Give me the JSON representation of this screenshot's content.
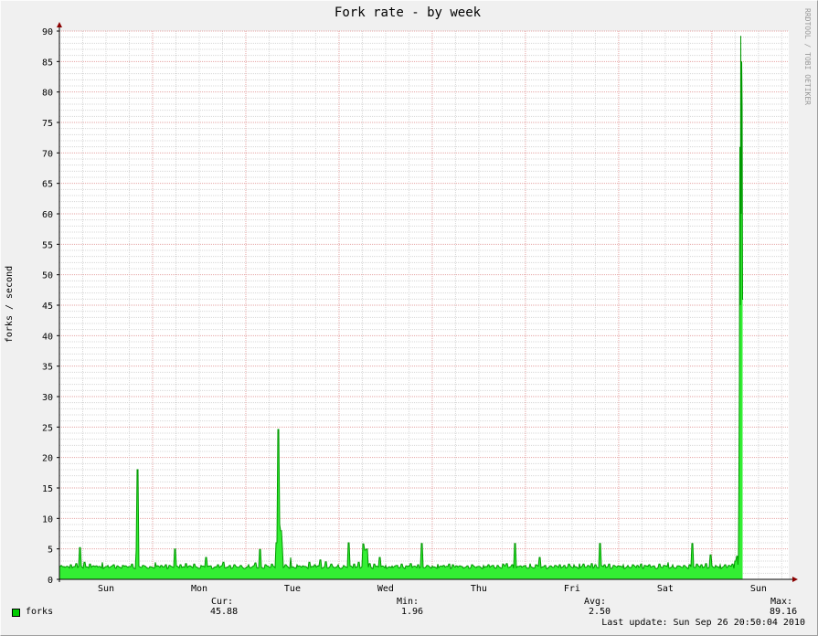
{
  "chart_data": {
    "type": "area",
    "title": "Fork rate - by week",
    "ylabel": "forks / second",
    "watermark": "RRDTOOL / TOBI OETIKER",
    "ylim": [
      0,
      90
    ],
    "y_ticks": [
      0,
      5,
      10,
      15,
      20,
      25,
      30,
      35,
      40,
      45,
      50,
      55,
      60,
      65,
      70,
      75,
      80,
      85,
      90
    ],
    "x_day_labels": [
      "Sun",
      "Mon",
      "Tue",
      "Wed",
      "Thu",
      "Fri",
      "Sat",
      "Sun"
    ],
    "x_range_days": [
      0,
      7.825
    ],
    "grid": true,
    "colors": {
      "background": "#f0f0f0",
      "canvas": "#ffffff",
      "area": "#00cc00",
      "area_fill": "#33ee33",
      "line": "#009900",
      "major_grid": "#e6a6a6",
      "minor_grid": "#d8d8d8",
      "axis": "#000000",
      "arrow": "#8b0000"
    },
    "series": [
      {
        "name": "forks",
        "baseline": 2.0,
        "spikes": [
          [
            0.02,
            2.3
          ],
          [
            0.05,
            2.1
          ],
          [
            0.12,
            2.4
          ],
          [
            0.18,
            2.6
          ],
          [
            0.22,
            5.2
          ],
          [
            0.27,
            2.8
          ],
          [
            0.33,
            2.5
          ],
          [
            0.4,
            2.2
          ],
          [
            0.46,
            2.8
          ],
          [
            0.52,
            2.3
          ],
          [
            0.58,
            2.4
          ],
          [
            0.62,
            2.2
          ],
          [
            0.68,
            2.3
          ],
          [
            0.75,
            2.1
          ],
          [
            0.78,
            2.5
          ],
          [
            0.83,
            4.8
          ],
          [
            0.84,
            18.0
          ],
          [
            0.9,
            2.3
          ],
          [
            0.97,
            2.1
          ],
          [
            1.03,
            2.8
          ],
          [
            1.09,
            2.3
          ],
          [
            1.14,
            2.4
          ],
          [
            1.18,
            2.3
          ],
          [
            1.24,
            5.0
          ],
          [
            1.3,
            2.4
          ],
          [
            1.36,
            2.6
          ],
          [
            1.4,
            2.2
          ],
          [
            1.45,
            2.5
          ],
          [
            1.52,
            2.3
          ],
          [
            1.57,
            3.6
          ],
          [
            1.62,
            2.2
          ],
          [
            1.7,
            2.4
          ],
          [
            1.76,
            2.8
          ],
          [
            1.83,
            2.3
          ],
          [
            1.88,
            2.4
          ],
          [
            1.95,
            2.3
          ],
          [
            2.03,
            2.4
          ],
          [
            2.1,
            2.7
          ],
          [
            2.15,
            4.9
          ],
          [
            2.21,
            2.4
          ],
          [
            2.28,
            2.5
          ],
          [
            2.33,
            6.0
          ],
          [
            2.34,
            5.5
          ],
          [
            2.345,
            24.6
          ],
          [
            2.36,
            9.0
          ],
          [
            2.37,
            5.4
          ],
          [
            2.38,
            8.0
          ],
          [
            2.39,
            5.2
          ],
          [
            2.43,
            2.4
          ],
          [
            2.48,
            3.6
          ],
          [
            2.55,
            2.4
          ],
          [
            2.61,
            2.2
          ],
          [
            2.68,
            2.8
          ],
          [
            2.74,
            2.4
          ],
          [
            2.8,
            3.2
          ],
          [
            2.86,
            2.9
          ],
          [
            2.92,
            2.5
          ],
          [
            2.99,
            2.4
          ],
          [
            3.05,
            2.3
          ],
          [
            3.1,
            6.0
          ],
          [
            3.16,
            2.5
          ],
          [
            3.21,
            2.8
          ],
          [
            3.26,
            5.8
          ],
          [
            3.28,
            4.8
          ],
          [
            3.3,
            5.0
          ],
          [
            3.33,
            2.6
          ],
          [
            3.38,
            2.5
          ],
          [
            3.44,
            3.6
          ],
          [
            3.5,
            2.3
          ],
          [
            3.57,
            2.2
          ],
          [
            3.62,
            2.3
          ],
          [
            3.67,
            2.5
          ],
          [
            3.72,
            2.2
          ],
          [
            3.77,
            2.6
          ],
          [
            3.8,
            2.1
          ],
          [
            3.85,
            2.4
          ],
          [
            3.89,
            5.9
          ],
          [
            3.95,
            2.3
          ],
          [
            4.0,
            2.2
          ],
          [
            4.06,
            2.5
          ],
          [
            4.12,
            2.3
          ],
          [
            4.18,
            2.5
          ],
          [
            4.22,
            2.4
          ],
          [
            4.26,
            2.2
          ],
          [
            4.32,
            2.1
          ],
          [
            4.38,
            2.2
          ],
          [
            4.43,
            2.4
          ],
          [
            4.49,
            2.1
          ],
          [
            4.55,
            2.3
          ],
          [
            4.6,
            2.4
          ],
          [
            4.65,
            2.3
          ],
          [
            4.7,
            2.3
          ],
          [
            4.76,
            2.5
          ],
          [
            4.8,
            2.6
          ],
          [
            4.86,
            2.4
          ],
          [
            4.89,
            5.9
          ],
          [
            4.95,
            2.2
          ],
          [
            5.0,
            2.3
          ],
          [
            5.05,
            2.6
          ],
          [
            5.11,
            2.4
          ],
          [
            5.15,
            3.6
          ],
          [
            5.21,
            2.3
          ],
          [
            5.27,
            2.2
          ],
          [
            5.32,
            2.3
          ],
          [
            5.37,
            2.4
          ],
          [
            5.42,
            2.3
          ],
          [
            5.47,
            2.5
          ],
          [
            5.52,
            2.4
          ],
          [
            5.58,
            2.6
          ],
          [
            5.62,
            2.5
          ],
          [
            5.67,
            2.3
          ],
          [
            5.71,
            2.6
          ],
          [
            5.75,
            2.4
          ],
          [
            5.8,
            5.9
          ],
          [
            5.85,
            2.4
          ],
          [
            5.9,
            2.5
          ],
          [
            5.95,
            2.3
          ],
          [
            6.0,
            2.2
          ],
          [
            6.05,
            2.4
          ],
          [
            6.1,
            2.3
          ],
          [
            6.15,
            2.4
          ],
          [
            6.2,
            2.3
          ],
          [
            6.24,
            2.5
          ],
          [
            6.28,
            2.3
          ],
          [
            6.33,
            2.4
          ],
          [
            6.38,
            2.2
          ],
          [
            6.44,
            2.5
          ],
          [
            6.49,
            2.3
          ],
          [
            6.53,
            2.8
          ],
          [
            6.58,
            2.4
          ],
          [
            6.63,
            2.2
          ],
          [
            6.7,
            2.3
          ],
          [
            6.76,
            2.4
          ],
          [
            6.79,
            5.9
          ],
          [
            6.84,
            2.5
          ],
          [
            6.89,
            2.4
          ],
          [
            6.94,
            2.6
          ],
          [
            6.99,
            4.0
          ],
          [
            7.04,
            2.3
          ],
          [
            7.09,
            2.4
          ],
          [
            7.14,
            2.4
          ],
          [
            7.18,
            2.3
          ],
          [
            7.22,
            2.5
          ],
          [
            7.25,
            3.0
          ],
          [
            7.27,
            3.8
          ]
        ],
        "tail": [
          [
            7.28,
            2.4
          ],
          [
            7.285,
            4.0
          ],
          [
            7.29,
            15.0
          ],
          [
            7.295,
            33.0
          ],
          [
            7.3,
            71.0
          ],
          [
            7.305,
            45.0
          ],
          [
            7.31,
            89.2
          ],
          [
            7.315,
            60.0
          ],
          [
            7.32,
            85.0
          ],
          [
            7.325,
            77.5
          ],
          [
            7.33,
            45.9
          ]
        ]
      }
    ]
  },
  "legend": {
    "swatch_color": "#00cc00",
    "series_label": "forks",
    "cur_label": "Cur:",
    "cur_value": "45.88",
    "min_label": "Min:",
    "min_value": "1.96",
    "avg_label": "Avg:",
    "avg_value": "2.50",
    "max_label": "Max:",
    "max_value": "89.16",
    "last_update": "Last update: Sun Sep 26 20:50:04 2010"
  }
}
